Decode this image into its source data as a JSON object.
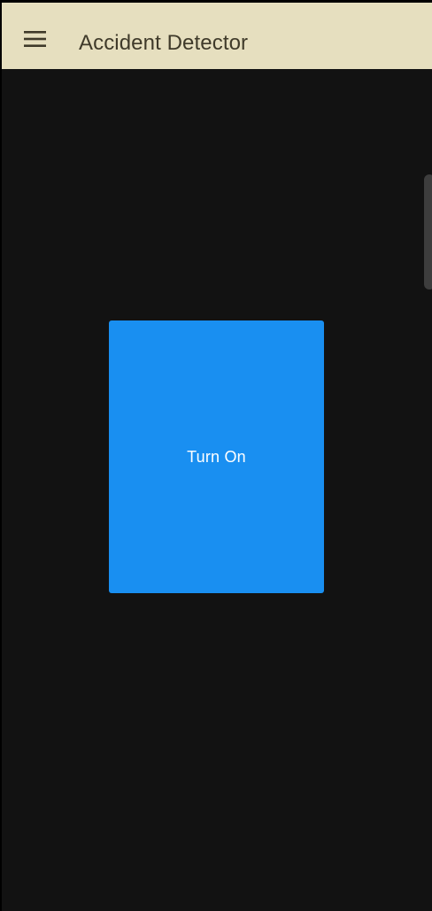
{
  "app_bar": {
    "title": "Accident Detector",
    "menu_icon": "hamburger-menu-icon",
    "background_color": "#e6dfbf",
    "title_color": "#3f3a2a"
  },
  "main": {
    "background_color": "#121212",
    "toggle_button": {
      "label": "Turn On",
      "color": "#198ff1",
      "text_color": "#ffffff"
    }
  }
}
